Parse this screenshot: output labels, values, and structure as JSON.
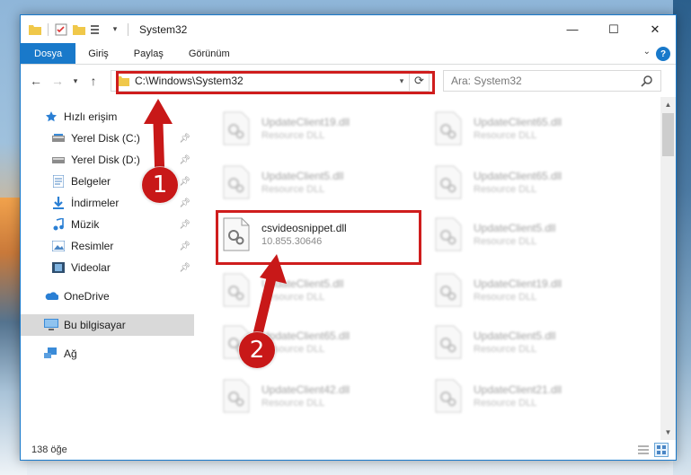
{
  "window": {
    "title": "System32",
    "controls": {
      "minimize": "—",
      "maximize": "☐",
      "close": "✕"
    }
  },
  "ribbon": {
    "tabs": [
      "Dosya",
      "Giriş",
      "Paylaş",
      "Görünüm"
    ]
  },
  "address": {
    "path": "C:\\Windows\\System32",
    "search_placeholder": "Ara: System32"
  },
  "sidebar": {
    "quick_access": "Hızlı erişim",
    "items": [
      {
        "label": "Yerel Disk (C:)",
        "icon": "drive-icon"
      },
      {
        "label": "Yerel Disk (D:)",
        "icon": "drive-icon"
      },
      {
        "label": "Belgeler",
        "icon": "documents-icon"
      },
      {
        "label": "İndirmeler",
        "icon": "downloads-icon"
      },
      {
        "label": "Müzik",
        "icon": "music-icon"
      },
      {
        "label": "Resimler",
        "icon": "pictures-icon"
      },
      {
        "label": "Videolar",
        "icon": "videos-icon"
      }
    ],
    "onedrive": "OneDrive",
    "this_pc": "Bu bilgisayar",
    "network": "Ağ"
  },
  "files": [
    {
      "name": "UpdateClient19.dll",
      "desc": "Resource DLL"
    },
    {
      "name": "UpdateClient65.dll",
      "desc": "Resource DLL"
    },
    {
      "name": "UpdateClient5.dll",
      "desc": "Resource DLL"
    },
    {
      "name": "UpdateClient65.dll",
      "desc": "Resource DLL"
    },
    {
      "name": "csvideosnippet.dll",
      "desc": "10.855.30646"
    },
    {
      "name": "UpdateClient5.dll",
      "desc": "Resource DLL"
    },
    {
      "name": "UpdateClient5.dll",
      "desc": "Resource DLL"
    },
    {
      "name": "UpdateClient19.dll",
      "desc": "Resource DLL"
    },
    {
      "name": "UpdateClient65.dll",
      "desc": "Resource DLL"
    },
    {
      "name": "UpdateClient5.dll",
      "desc": "Resource DLL"
    },
    {
      "name": "UpdateClient42.dll",
      "desc": "Resource DLL"
    },
    {
      "name": "UpdateClient21.dll",
      "desc": "Resource DLL"
    }
  ],
  "status": {
    "item_count": "138 öğe"
  },
  "annotations": {
    "step1": "1",
    "step2": "2"
  },
  "colors": {
    "accent": "#1979ca",
    "highlight": "#cf1d1d",
    "badge": "#c81818"
  }
}
